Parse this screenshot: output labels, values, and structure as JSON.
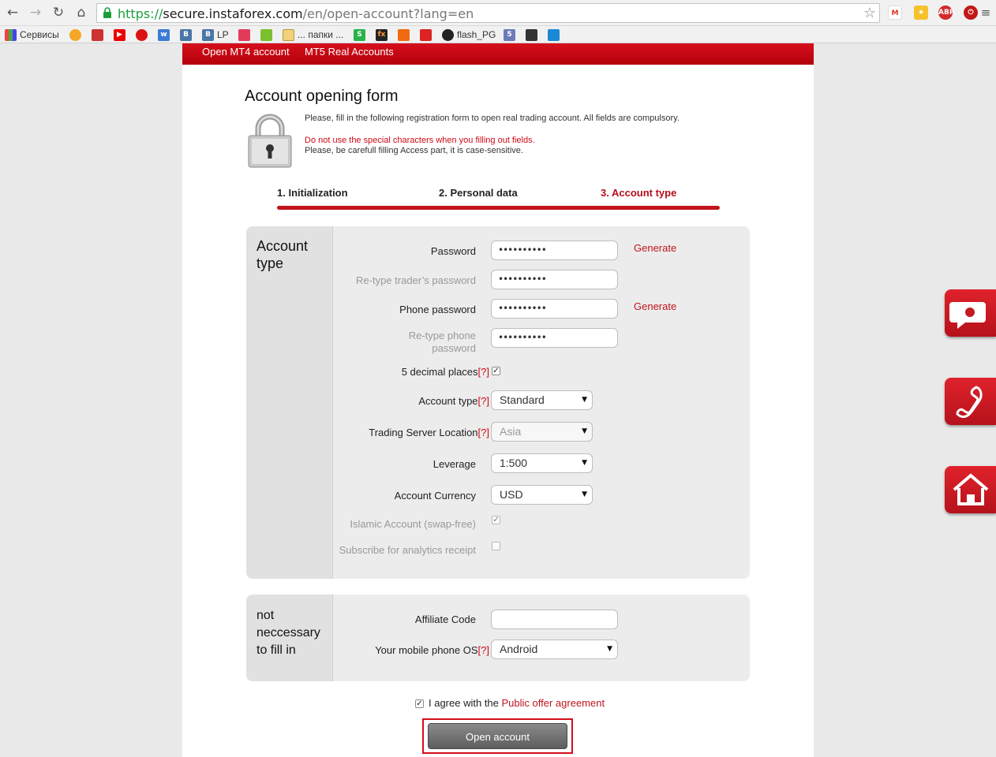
{
  "browser": {
    "url_scheme": "https://",
    "url_host": "secure.instaforex.com",
    "url_path": "/en/open-account?lang=en",
    "bookmarks": [
      "Сервисы",
      "LP",
      "... папки ...",
      "flash_PG"
    ]
  },
  "site_nav": [
    "Open MT4 account",
    "MT5 Real Accounts"
  ],
  "form": {
    "title": "Account opening form",
    "intro": "Please, fill in the following registration form to open real trading account. All fields are compulsory.",
    "warning_special": "Do not use the special characters when you filling out fields.",
    "warning_access": "Please, be carefull filling Access part, it is case-sensitive."
  },
  "steps": [
    "1. Initialization",
    "2. Personal data",
    "3. Account type"
  ],
  "account_panel": {
    "title_line1": "Account",
    "title_line2": "type",
    "password_label": "Password",
    "password_value": "••••••••••",
    "retype_trader_label": "Re-type trader’s password",
    "retype_trader_value": "••••••••••",
    "phone_password_label": "Phone password",
    "phone_password_value": "••••••••••",
    "retype_phone_label_1": "Re-type phone",
    "retype_phone_label_2": "password",
    "retype_phone_value": "••••••••••",
    "generate_label": "Generate",
    "help_marker": "[?]",
    "decimal_label": "5 decimal places",
    "account_type_label": "Account type",
    "account_type_value": "Standard",
    "server_label": "Trading Server Location",
    "server_value": "Asia",
    "leverage_label": "Leverage",
    "leverage_value": "1:500",
    "currency_label": "Account Currency",
    "currency_value": "USD",
    "islamic_label": "Islamic Account (swap-free)",
    "subscribe_label": "Subscribe for analytics receipt",
    "checkmark": "✓",
    "dropdown_arrow": "▼"
  },
  "optional_panel": {
    "title_line1": "not",
    "title_line2": "neccessary",
    "title_line3": "to fill in",
    "affiliate_label": "Affiliate Code",
    "affiliate_value": "",
    "mobile_os_label": "Your mobile phone OS",
    "mobile_os_value": "Android"
  },
  "agreement": {
    "text": "I agree with the",
    "link": "Public offer agreement"
  },
  "submit_label": "Open account",
  "colors": {
    "brand_red": "#c0141f",
    "panel_gray": "#ececec",
    "button_gray": "#6e6e6e"
  }
}
